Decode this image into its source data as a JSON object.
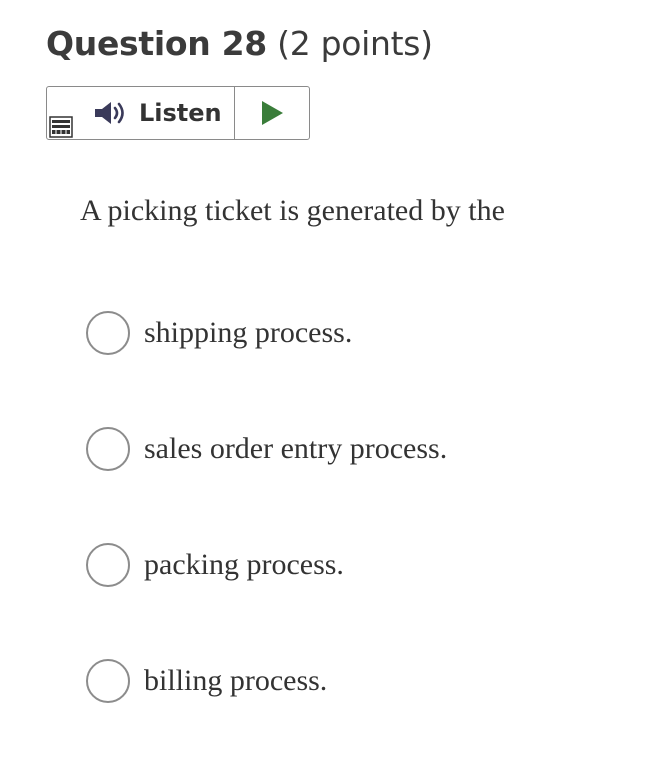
{
  "question": {
    "title": "Question 28",
    "points": "(2 points)",
    "text": "A picking ticket is generated by the"
  },
  "listen": {
    "label": "Listen",
    "menu_icon": "menu-icon",
    "speaker_icon": "speaker-icon",
    "play_icon": "play-icon",
    "play_color": "#3a7d3a"
  },
  "options": [
    {
      "label": "shipping process.",
      "selected": false
    },
    {
      "label": "sales order entry process.",
      "selected": false
    },
    {
      "label": "packing process.",
      "selected": false
    },
    {
      "label": "billing process.",
      "selected": false
    }
  ]
}
